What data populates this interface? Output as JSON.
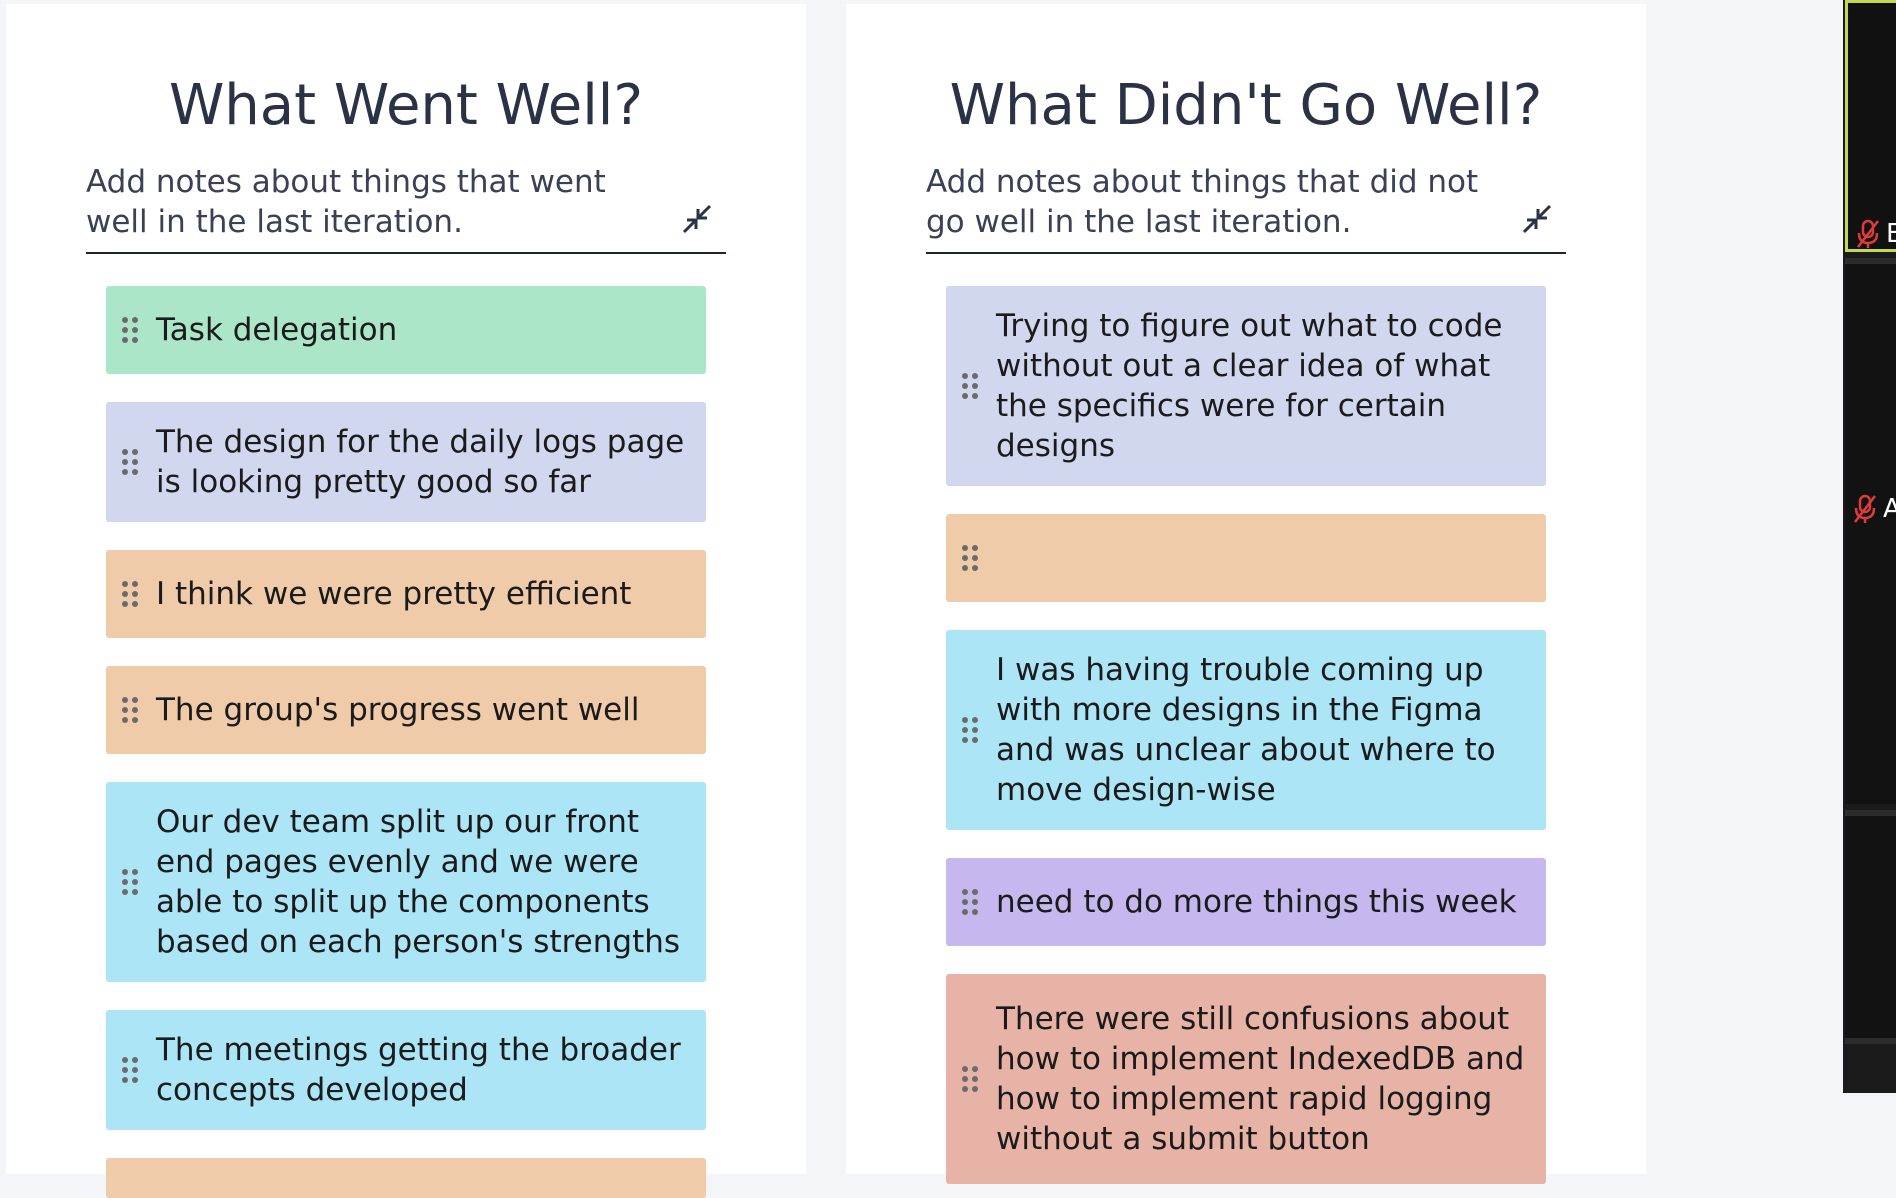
{
  "columns": [
    {
      "title": "What Went Well?",
      "prompt": "Add notes about things that went well in the last iteration.",
      "notes": [
        {
          "text": "Task delegation",
          "color": "#abe6c9"
        },
        {
          "text": "The design for the daily logs page is looking pretty good so far",
          "color": "#d0d7ee"
        },
        {
          "text": "I think we were pretty efficient",
          "color": "#f0cba9"
        },
        {
          "text": "The group's progress went well",
          "color": "#f0cba9"
        },
        {
          "text": "Our dev team split up our front end pages evenly and we were able to split up the components based on each person's strengths",
          "color": "#abe5f6"
        },
        {
          "text": "The meetings getting the broader concepts developed",
          "color": "#abe5f6"
        },
        {
          "text": "",
          "color": "#f0cba9"
        }
      ]
    },
    {
      "title": "What Didn't Go Well?",
      "prompt": "Add notes about things that did not go well in the last iteration.",
      "notes": [
        {
          "text": "Trying to figure out what to code without out a clear idea of what the specifics were for certain designs",
          "color": "#d0d7ee"
        },
        {
          "text": "",
          "color": "#f0cba9"
        },
        {
          "text": "I was having trouble coming up with more designs in the Figma and was unclear about where to move design-wise",
          "color": "#abe5f6"
        },
        {
          "text": "need to do more things this week",
          "color": "#c6b8ee"
        },
        {
          "text": "There were still confusions about how to implement IndexedDB and how to implement rapid logging without a submit button",
          "color": "#e8b3a7"
        }
      ]
    }
  ],
  "side_panel": {
    "participants": [
      {
        "initial": "E",
        "muted": true
      },
      {
        "initial": "A",
        "muted": true
      }
    ]
  },
  "icons": {
    "collapse": "collapse-arrows-icon",
    "drag": "drag-handle-icon",
    "mic_muted": "mic-muted-icon"
  }
}
